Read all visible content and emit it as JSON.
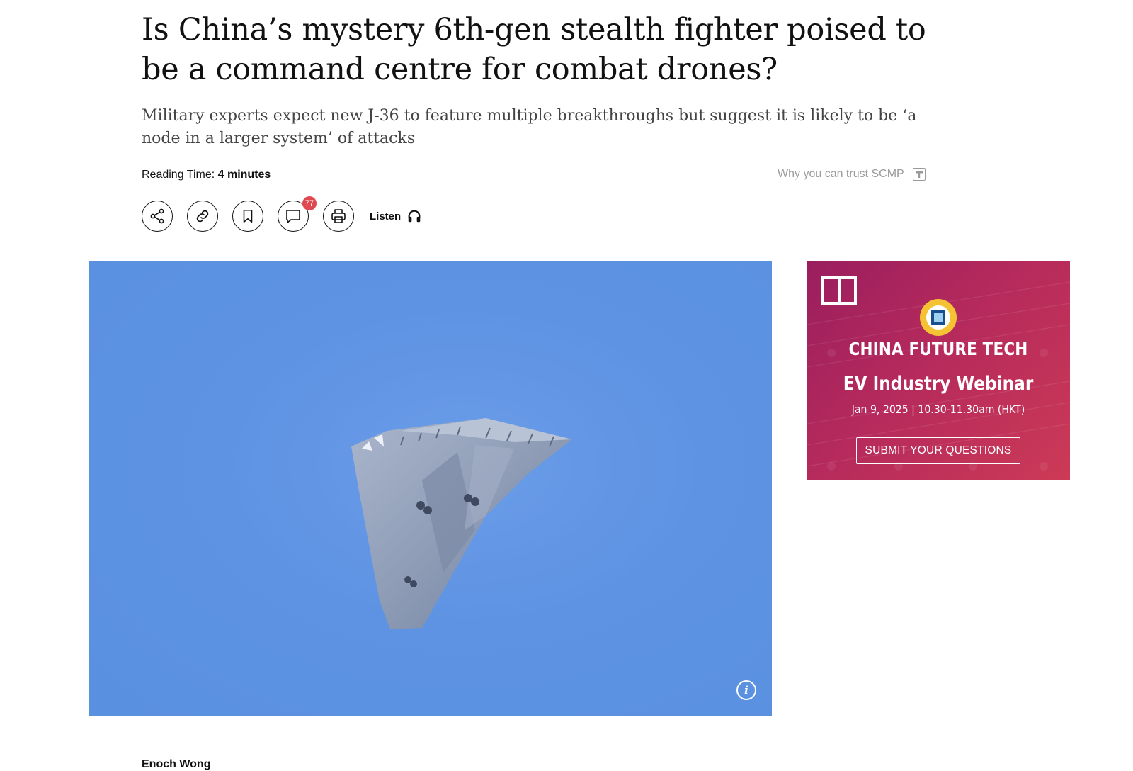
{
  "article": {
    "headline": "Is China’s mystery 6th-gen stealth fighter poised to be a command centre for combat drones?",
    "subheadline": "Military experts expect new J-36 to feature multiple breakthroughs but suggest it is likely to be ‘a node in a larger system’ of attacks",
    "reading_time_label": "Reading Time:",
    "reading_time_value": "4 minutes",
    "trust_label": "Why you can trust SCMP",
    "author": "Enoch Wong"
  },
  "toolbar": {
    "icons": [
      "share-icon",
      "link-icon",
      "bookmark-icon",
      "comment-icon",
      "print-icon",
      "headphones-icon"
    ],
    "comment_count": "77",
    "listen_label": "Listen"
  },
  "hero": {
    "info_label": "i",
    "background_color": "#5e93e3"
  },
  "ad": {
    "title": "CHINA FUTURE TECH",
    "subtitle": "EV Industry Webinar",
    "date_line": "Jan 9, 2025 | 10.30-11.30am (HKT)",
    "cta_label": "SUBMIT YOUR QUESTIONS",
    "accent_color": "#b52a5c"
  }
}
